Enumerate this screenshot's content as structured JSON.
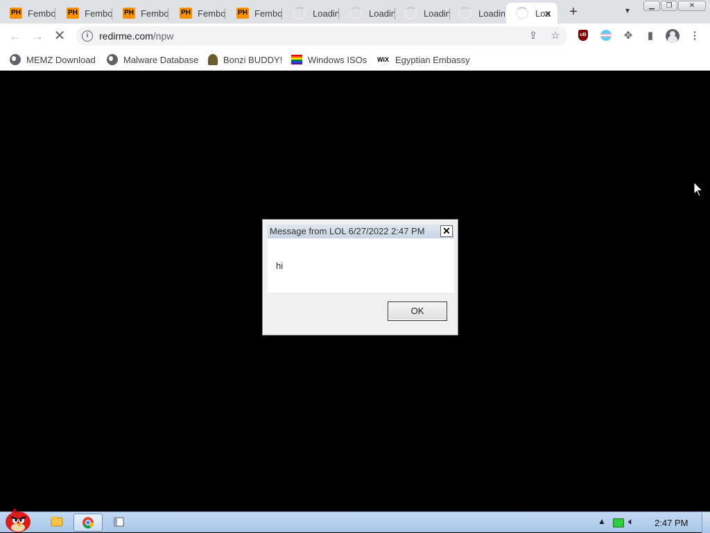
{
  "tabs": [
    {
      "favicon": "ph",
      "title": "Fembo"
    },
    {
      "favicon": "ph",
      "title": "Fembo"
    },
    {
      "favicon": "ph",
      "title": "Fembo"
    },
    {
      "favicon": "ph",
      "title": "Fembo"
    },
    {
      "favicon": "ph",
      "title": "Fembo"
    },
    {
      "favicon": "loading",
      "title": "Loadin"
    },
    {
      "favicon": "loading",
      "title": "Loadin"
    },
    {
      "favicon": "loading",
      "title": "Loadin"
    },
    {
      "favicon": "loading",
      "title": "Loadin"
    },
    {
      "favicon": "loading",
      "title": "Loa",
      "active": true
    }
  ],
  "ph_label": "PH",
  "address": {
    "host": "redirme.com",
    "path": "/npw"
  },
  "bookmarks": [
    {
      "icon": "globe-icon",
      "label": "MEMZ Download"
    },
    {
      "icon": "globe-icon",
      "label": "Malware Database"
    },
    {
      "icon": "bonzi-icon",
      "label": "Bonzi BUDDY!"
    },
    {
      "icon": "rainbow-flag-icon",
      "label": "Windows ISOs"
    },
    {
      "icon": "wix-icon",
      "label": "Egyptian Embassy"
    }
  ],
  "wix_label": "WiX",
  "ublock_label": "uB",
  "dialog": {
    "title": "Message from LOL 6/27/2022 2:47 PM",
    "message": "hi",
    "ok_label": "OK"
  },
  "taskbar": {
    "clock": "2:47 PM"
  },
  "colors": {
    "ph_orange": "#ff9000",
    "taskbar": "#b8d1ef",
    "ublock": "#800000"
  }
}
